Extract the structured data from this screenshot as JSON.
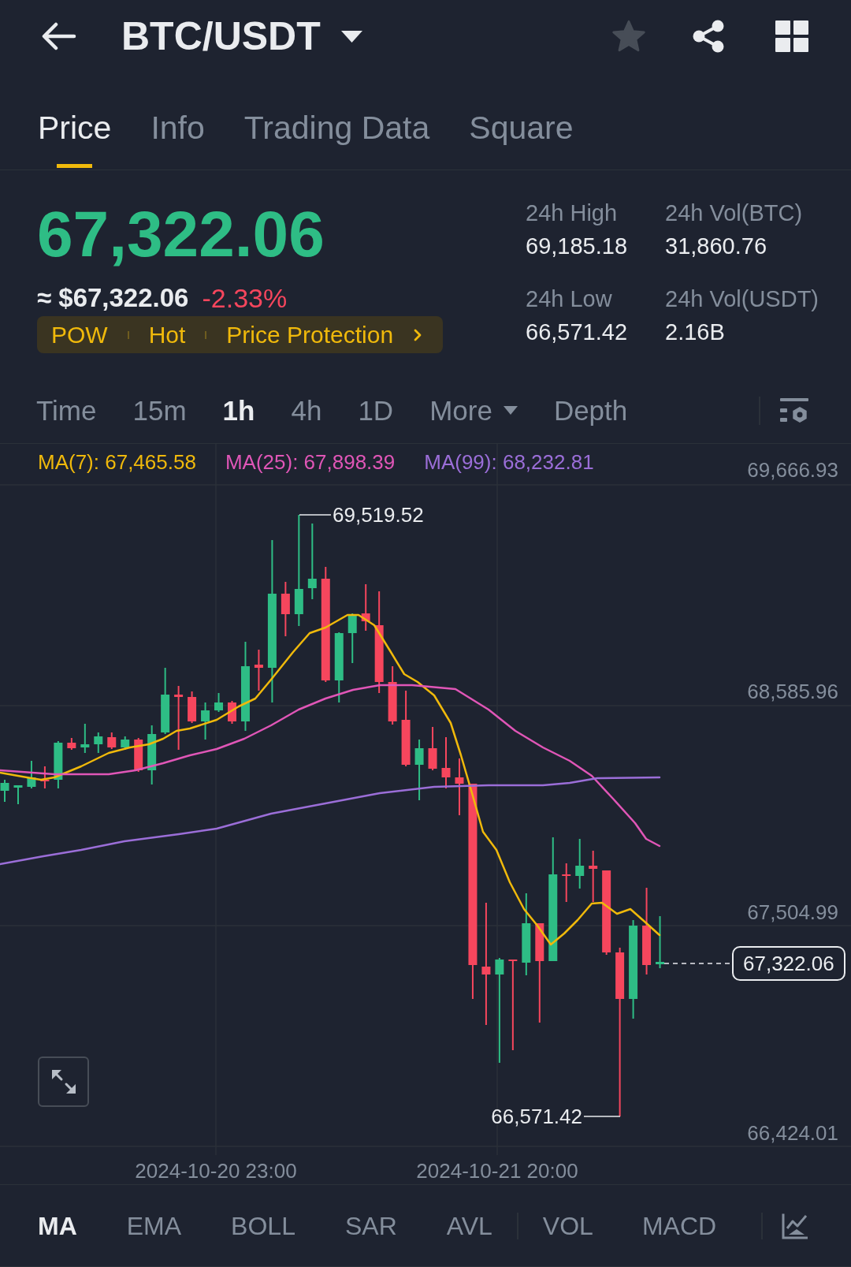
{
  "header": {
    "title": "BTC/USDT",
    "favorite": false
  },
  "tabs": [
    {
      "label": "Price",
      "selected": true
    },
    {
      "label": "Info",
      "selected": false
    },
    {
      "label": "Trading Data",
      "selected": false
    },
    {
      "label": "Square",
      "selected": false
    }
  ],
  "ticker": {
    "last_price": "67,322.06",
    "fiat_price": "≈ $67,322.06",
    "change": "-2.33%",
    "tags": [
      "POW",
      "Hot",
      "Price Protection"
    ],
    "stats": [
      {
        "label": "24h High",
        "value": "69,185.18"
      },
      {
        "label": "24h Vol(BTC)",
        "value": "31,860.76"
      },
      {
        "label": "24h Low",
        "value": "66,571.42"
      },
      {
        "label": "24h Vol(USDT)",
        "value": "2.16B"
      }
    ]
  },
  "intervals": [
    {
      "label": "Time",
      "kind": "option",
      "selected": false
    },
    {
      "label": "15m",
      "kind": "option",
      "selected": false
    },
    {
      "label": "1h",
      "kind": "option",
      "selected": true
    },
    {
      "label": "4h",
      "kind": "option",
      "selected": false
    },
    {
      "label": "1D",
      "kind": "option",
      "selected": false
    },
    {
      "label": "More",
      "kind": "dropdown",
      "selected": false
    },
    {
      "label": "Depth",
      "kind": "option",
      "selected": false
    }
  ],
  "chart": {
    "indicators": [
      {
        "label": "MA(7): 67,465.58",
        "color": "#f0b90b"
      },
      {
        "label": "MA(25): 67,898.39",
        "color": "#e056b7"
      },
      {
        "label": "MA(99): 68,232.81",
        "color": "#9b6ed8"
      }
    ],
    "price_axis": [
      "69,666.93",
      "68,585.96",
      "67,504.99",
      "66,424.01"
    ],
    "time_axis": [
      "2024-10-20 23:00",
      "2024-10-21 20:00"
    ],
    "high_label": "69,519.52",
    "low_label": "66,571.42",
    "last_price_label": "67,322.06"
  },
  "indicator_tabs": {
    "main": [
      {
        "label": "MA",
        "selected": true
      },
      {
        "label": "EMA",
        "selected": false
      },
      {
        "label": "BOLL",
        "selected": false
      },
      {
        "label": "SAR",
        "selected": false
      },
      {
        "label": "AVL",
        "selected": false
      }
    ],
    "sub": [
      {
        "label": "VOL",
        "selected": false
      },
      {
        "label": "MACD",
        "selected": false
      }
    ]
  }
}
